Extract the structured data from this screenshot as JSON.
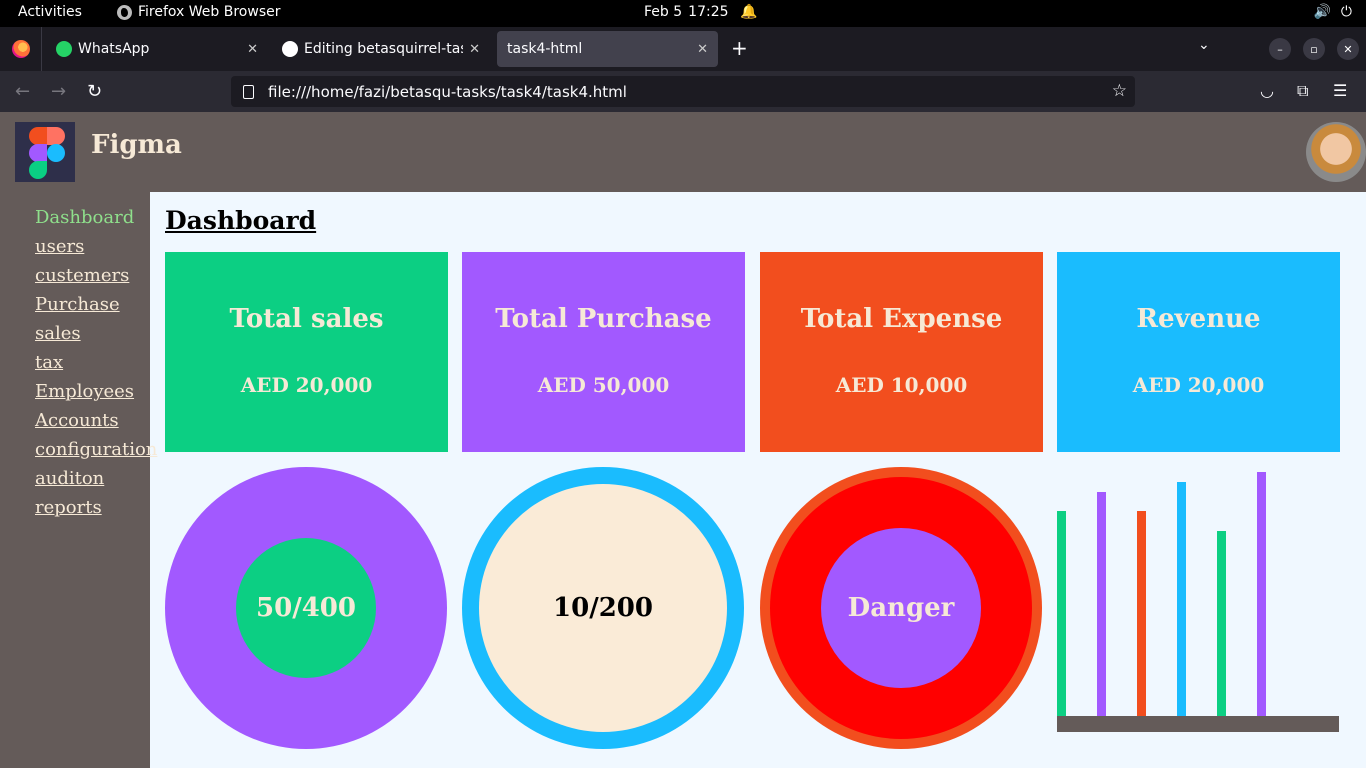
{
  "system_bar": {
    "activities": "Activities",
    "app_name": "Firefox Web Browser",
    "date": "Feb 5",
    "time": "17:25"
  },
  "browser": {
    "tabs": [
      {
        "label": "WhatsApp",
        "icon": "whatsapp-icon",
        "color": "#25d366"
      },
      {
        "label": "Editing betasquirrel-tasks",
        "icon": "github-icon",
        "color": "#ffffff"
      },
      {
        "label": "task4-html",
        "icon": "",
        "color": ""
      }
    ],
    "url": "file:///home/fazi/betasqu-tasks/task4/task4.html"
  },
  "site": {
    "brand": "Figma",
    "page_title": "Dashboard",
    "sidebar": [
      {
        "label": "Dashboard",
        "active": true
      },
      {
        "label": "users"
      },
      {
        "label": "custemers"
      },
      {
        "label": "Purchase"
      },
      {
        "label": "sales"
      },
      {
        "label": "tax"
      },
      {
        "label": "Employees"
      },
      {
        "label": "Accounts"
      },
      {
        "label": "configuration"
      },
      {
        "label": "auditon"
      },
      {
        "label": "reports"
      }
    ],
    "cards": [
      {
        "title": "Total sales",
        "value": "AED 20,000",
        "color": "#0ccf83"
      },
      {
        "title": "Total Purchase",
        "value": "AED 50,000",
        "color": "#a259ff"
      },
      {
        "title": "Total Expense",
        "value": "AED 10,000",
        "color": "#f24e1e"
      },
      {
        "title": "Revenue",
        "value": "AED 20,000",
        "color": "#1abcfe"
      }
    ],
    "circles": [
      {
        "label": "50/400",
        "outer": "#a259ff",
        "inner": "#0ccf83"
      },
      {
        "label": "10/200",
        "outer": "#1abcfe",
        "inner": "#faebd7"
      },
      {
        "label": "Danger",
        "outer": "#f24e1e",
        "ring": "#ff0000",
        "inner": "#a259ff"
      }
    ],
    "bar_chart": {
      "bars": [
        {
          "level": 0.84,
          "color": "#0ccf83"
        },
        {
          "level": 0.92,
          "color": "#a259ff"
        },
        {
          "level": 0.84,
          "color": "#f24e1e"
        },
        {
          "level": 0.96,
          "color": "#1abcfe"
        },
        {
          "level": 0.76,
          "color": "#0ccf83"
        },
        {
          "level": 1.0,
          "color": "#a259ff"
        }
      ]
    }
  }
}
